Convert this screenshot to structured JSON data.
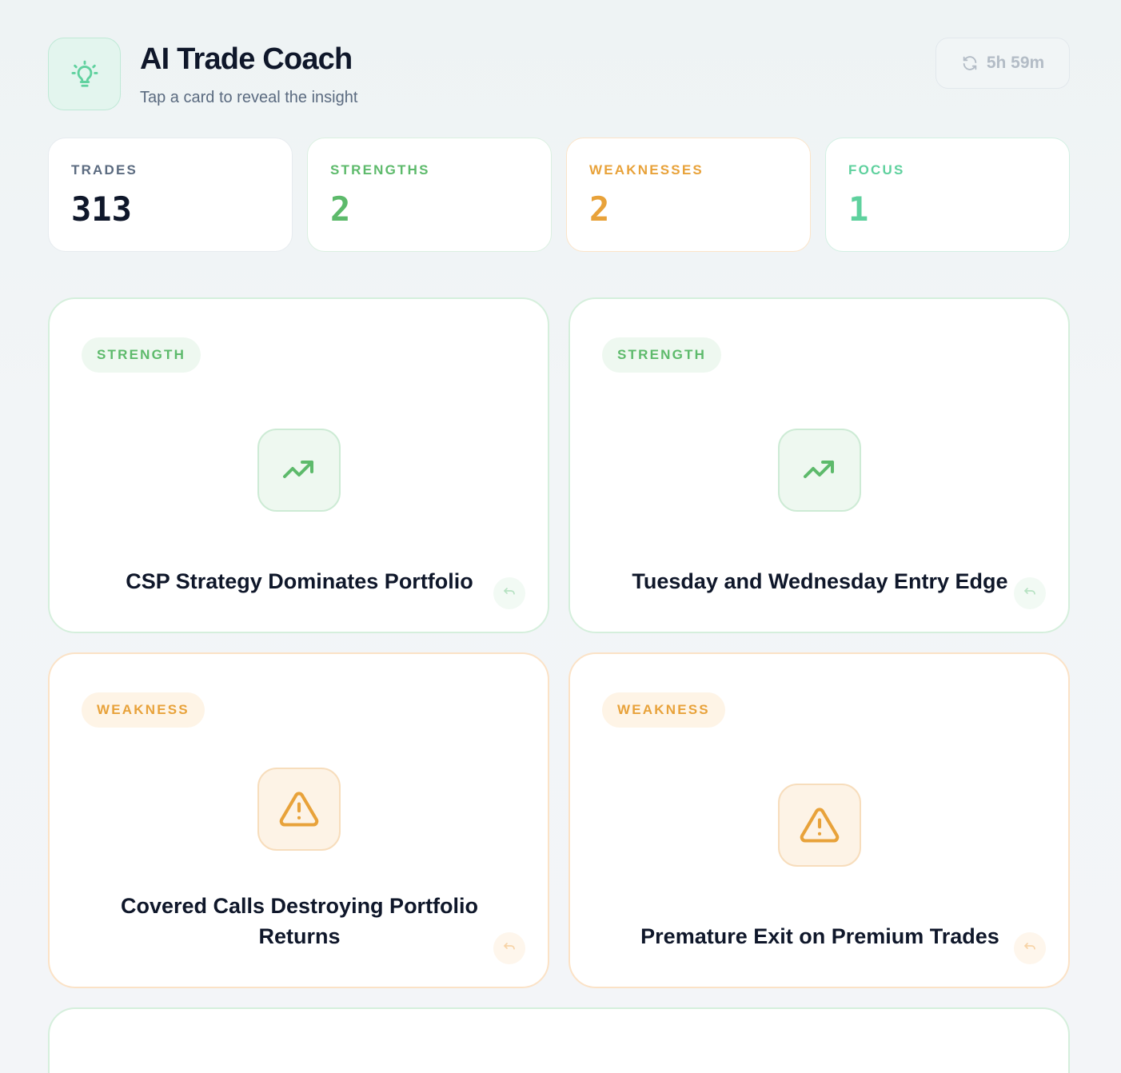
{
  "header": {
    "title": "AI Trade Coach",
    "subtitle": "Tap a card to reveal the insight",
    "logo_icon": "lightbulb-icon",
    "refresh_label": "5h 59m",
    "refresh_icon": "refresh-icon"
  },
  "stats": [
    {
      "label": "TRADES",
      "value": "313"
    },
    {
      "label": "STRENGTHS",
      "value": "2",
      "color": "#5dba6b"
    },
    {
      "label": "WEAKNESSES",
      "value": "2",
      "color": "#e8a23a"
    },
    {
      "label": "FOCUS",
      "value": "1",
      "color": "#5fd19e"
    }
  ],
  "cards": [
    {
      "badge": "STRENGTH",
      "icon": "trending-up-icon",
      "title": "CSP Strategy Dominates Portfolio"
    },
    {
      "badge": "STRENGTH",
      "icon": "trending-up-icon",
      "title": "Tuesday and Wednesday Entry Edge"
    },
    {
      "badge": "WEAKNESS",
      "icon": "warning-icon",
      "title": "Covered Calls Destroying Portfolio Returns"
    },
    {
      "badge": "WEAKNESS",
      "icon": "warning-icon",
      "title": "Premature Exit on Premium Trades"
    }
  ],
  "colors": {
    "strength": "#5dba6b",
    "weakness": "#e8a23a",
    "focus": "#5fd19e"
  }
}
